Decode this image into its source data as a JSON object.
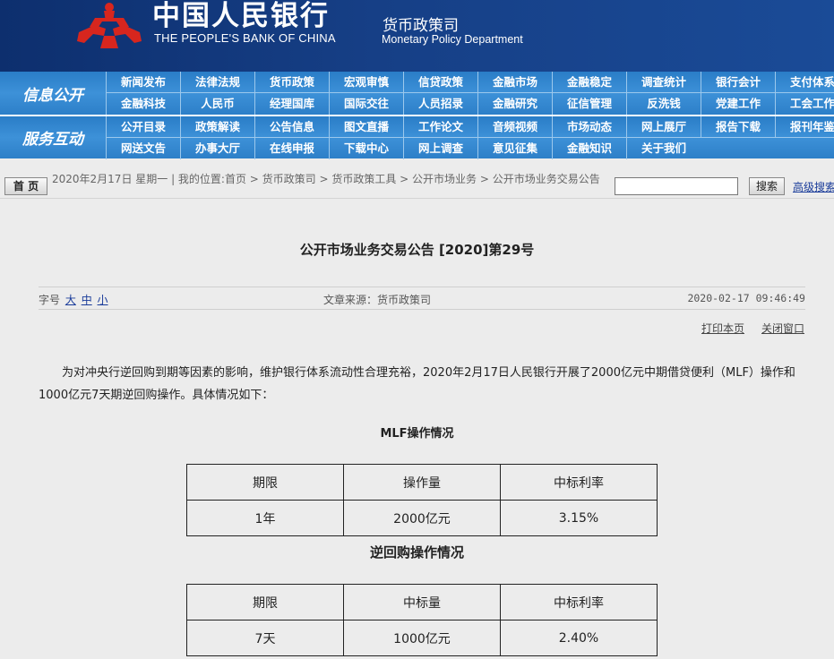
{
  "header": {
    "bank_name_cn": "中国人民银行",
    "bank_name_en": "THE PEOPLE'S BANK OF CHINA",
    "dept_cn": "货币政策司",
    "dept_en": "Monetary Policy Department",
    "colors": {
      "header_bg": "#163f86",
      "logo_red": "#d7261e",
      "nav_blue": "#3d91d8"
    }
  },
  "nav": {
    "block1_title": "信息公开",
    "block1_row1": [
      "新闻发布",
      "法律法规",
      "货币政策",
      "宏观审慎",
      "信贷政策",
      "金融市场",
      "金融稳定",
      "调查统计",
      "银行会计",
      "支付体系"
    ],
    "block1_row2": [
      "金融科技",
      "人民币",
      "经理国库",
      "国际交往",
      "人员招录",
      "金融研究",
      "征信管理",
      "反洗钱",
      "党建工作",
      "工会工作"
    ],
    "block2_title": "服务互动",
    "block2_row1": [
      "公开目录",
      "政策解读",
      "公告信息",
      "图文直播",
      "工作论文",
      "音频视频",
      "市场动态",
      "网上展厅",
      "报告下载",
      "报刊年鉴"
    ],
    "block2_row2": [
      "网送文告",
      "办事大厅",
      "在线申报",
      "下载中心",
      "网上调查",
      "意见征集",
      "金融知识",
      "关于我们"
    ]
  },
  "crumbbar": {
    "home_label": "首 页",
    "crumb": "2020年2月17日 星期一 | 我的位置:首页 > 货币政策司 > 货币政策工具 > 公开市场业务 > 公开市场业务交易公告",
    "search_value": "",
    "search_label": "搜索",
    "advanced_label": "高级搜索"
  },
  "article": {
    "title": "公开市场业务交易公告 [2020]第29号",
    "font_size_label": "字号",
    "font_sizes": [
      "大",
      "中",
      "小"
    ],
    "source": "文章来源：货币政策司",
    "date": "2020-02-17 09:46:49",
    "print_label": "打印本页",
    "close_label": "关闭窗口",
    "paragraph": "为对冲央行逆回购到期等因素的影响，维护银行体系流动性合理充裕，2020年2月17日人民银行开展了2000亿元中期借贷便利（MLF）操作和1000亿元7天期逆回购操作。具体情况如下：",
    "mlf_heading": "MLF操作情况",
    "mlf_table": {
      "headers": [
        "期限",
        "操作量",
        "中标利率"
      ],
      "rows": [
        [
          "1年",
          "2000亿元",
          "3.15%"
        ]
      ]
    },
    "reverse_heading": "逆回购操作情况",
    "reverse_table": {
      "headers": [
        "期限",
        "中标量",
        "中标利率"
      ],
      "rows": [
        [
          "7天",
          "1000亿元",
          "2.40%"
        ]
      ]
    }
  }
}
